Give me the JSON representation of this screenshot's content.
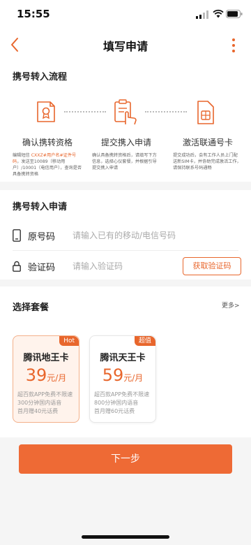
{
  "status_bar": {
    "time": "15:55"
  },
  "nav": {
    "title": "填写申请"
  },
  "flow": {
    "title": "携号转入流程",
    "steps": [
      {
        "name": "确认携转资格",
        "desc_pre": "编辑短信 ",
        "desc_hl": "CXXZ#用户名#证件号码",
        "desc_post": "，发送至10089（移动用户）/10001（电信用户），查询是否具备携转资格"
      },
      {
        "name": "提交携入申请",
        "desc": "确认具备携转资格后，请填写下方信息，选择心仪套餐，并根据引导提交携入申请"
      },
      {
        "name": "激活联通号卡",
        "desc": "提交成功后，会有工作人员上门配送新SIM卡，并协助完成激活工作，请保持联系号码通畅"
      }
    ]
  },
  "apply": {
    "title": "携号转入申请",
    "number_label": "原号码",
    "number_placeholder": "请输入已有的移动/电信号码",
    "code_label": "验证码",
    "code_placeholder": "请输入验证码",
    "code_button": "获取验证码"
  },
  "plans": {
    "title": "选择套餐",
    "more": "更多>",
    "items": [
      {
        "badge": "Hot",
        "name": "腾讯地王卡",
        "price": "39",
        "unit": "元/月",
        "features": [
          "超百款APP免费不限速",
          "300分钟国内语音",
          "首月赠40元话费"
        ]
      },
      {
        "badge": "超值",
        "name": "腾讯天王卡",
        "price": "59",
        "unit": "元/月",
        "features": [
          "超百款APP免费不限速",
          "800分钟国内语音",
          "首月赠60元话费"
        ]
      }
    ]
  },
  "footer": {
    "next_button": "下一步"
  },
  "colors": {
    "accent": "#e8662c",
    "button": "#ee6a35"
  }
}
